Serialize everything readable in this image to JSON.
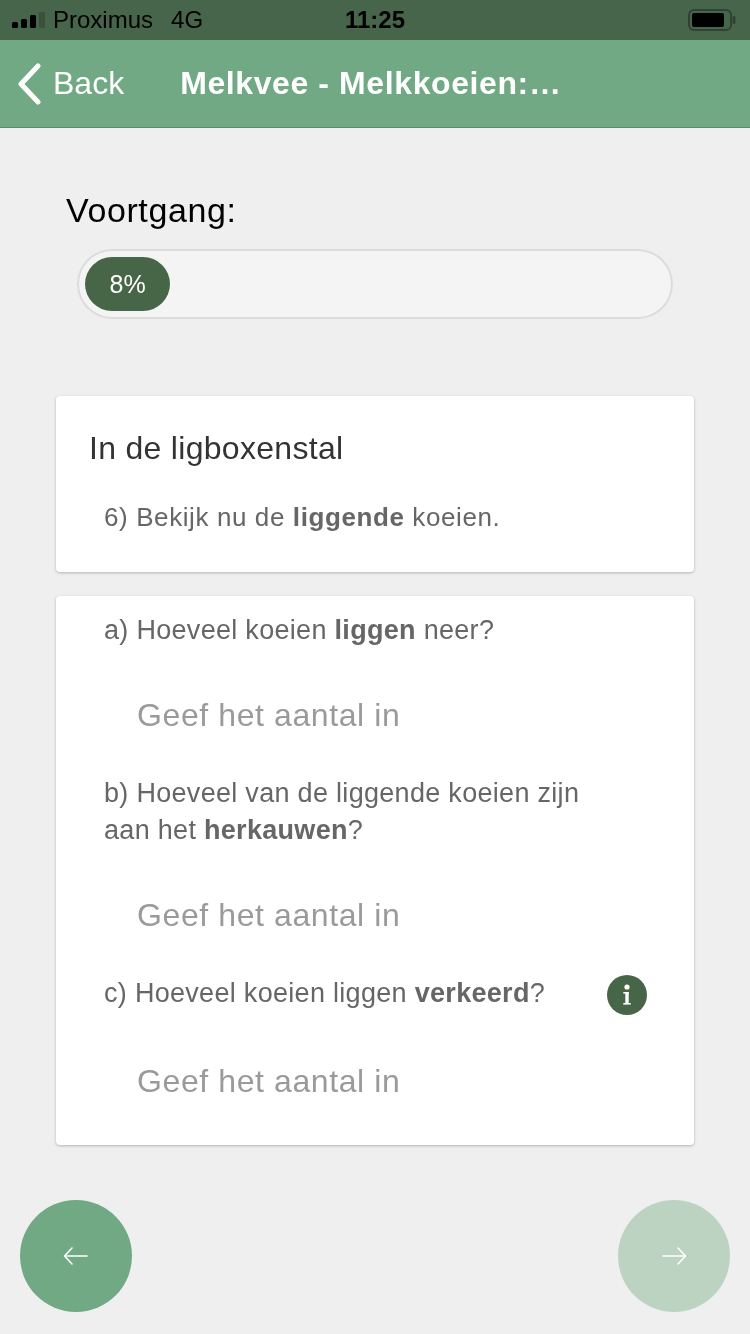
{
  "status_bar": {
    "carrier": "Proximus",
    "network": "4G",
    "time": "11:25"
  },
  "nav_bar": {
    "back": "Back",
    "title": "Melkvee - Melkkoeien:…"
  },
  "progress": {
    "label": "Voortgang:",
    "level": 0.17,
    "reading": "8%"
  },
  "intro_card": {
    "title": "In de ligboxenstal",
    "text": "6) Bekijk nu de **liggende** koeien."
  },
  "questions": [
    {
      "text": "a) Hoeveel koeien **liggen** neer?",
      "placeholder": "Geef het aantal in",
      "info": false
    },
    {
      "text": "b) Hoeveel van de liggende koeien zijn aan het **herkauwen**?",
      "placeholder": "Geef het aantal in",
      "info": false
    },
    {
      "text": "c) Hoeveel koeien liggen **verkeerd**?",
      "placeholder": "Geef het aantal in",
      "info": true
    }
  ],
  "nav_buttons": [
    {
      "kind": "previous",
      "disabled": false
    },
    {
      "kind": "next",
      "disabled": true
    }
  ]
}
